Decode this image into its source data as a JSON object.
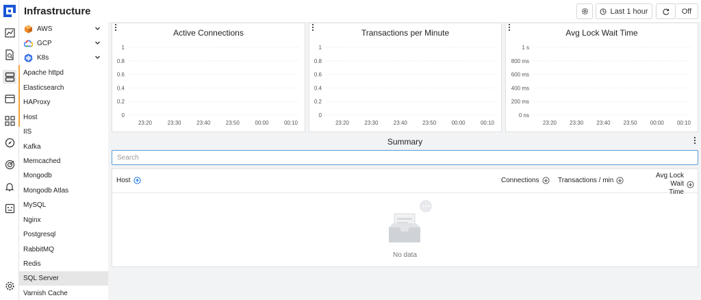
{
  "header": {
    "title": "Infrastructure",
    "time_range": "Last 1 hour",
    "refresh_state": "Off"
  },
  "nav": {
    "clouds": [
      {
        "label": "AWS",
        "icon": "aws-icon"
      },
      {
        "label": "GCP",
        "icon": "gcp-icon"
      },
      {
        "label": "K8s",
        "icon": "k8s-icon"
      }
    ],
    "items": [
      "Apache httpd",
      "Elasticsearch",
      "HAProxy",
      "Host",
      "IIS",
      "Kafka",
      "Memcached",
      "Mongodb",
      "Mongodb Atlas",
      "MySQL",
      "Nginx",
      "Postgresql",
      "RabbitMQ",
      "Redis",
      "SQL Server",
      "Varnish Cache"
    ],
    "active": "SQL Server"
  },
  "charts": [
    {
      "title": "Active Connections",
      "y_ticks": [
        "1",
        "0.8",
        "0.6",
        "0.4",
        "0.2",
        "0"
      ],
      "x_ticks": [
        "23:20",
        "23:30",
        "23:40",
        "23:50",
        "00:00",
        "00:10"
      ]
    },
    {
      "title": "Transactions per Minute",
      "y_ticks": [
        "1",
        "0.8",
        "0.6",
        "0.4",
        "0.2",
        "0"
      ],
      "x_ticks": [
        "23:20",
        "23:30",
        "23:40",
        "23:50",
        "00:00",
        "00:10"
      ]
    },
    {
      "title": "Avg Lock Wait Time",
      "y_ticks": [
        "1 s",
        "800 ms",
        "600 ms",
        "400 ms",
        "200 ms",
        "0 ns"
      ],
      "x_ticks": [
        "23:20",
        "23:30",
        "23:40",
        "23:50",
        "00:00",
        "00:10"
      ]
    }
  ],
  "summary": {
    "title": "Summary",
    "search_placeholder": "Search",
    "columns": {
      "host": "Host",
      "connections": "Connections",
      "transactions": "Transactions / min",
      "lock_wait_line1": "Avg Lock Wait",
      "lock_wait_line2": "Time"
    },
    "empty_text": "No data"
  },
  "colors": {
    "accent": "#1a73e8",
    "active_marker": "#f0a13a",
    "search_border": "#5b9bd5"
  }
}
